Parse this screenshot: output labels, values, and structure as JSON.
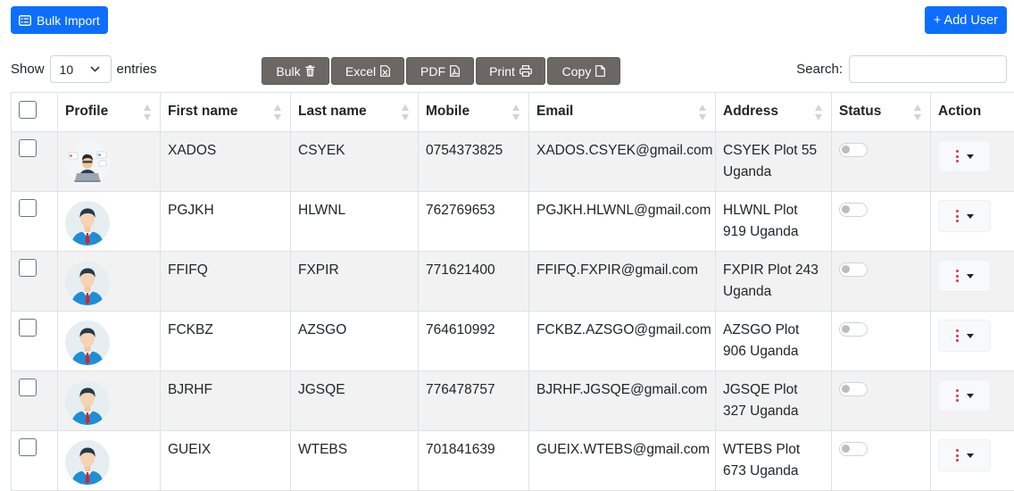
{
  "toolbar": {
    "bulk_import_label": "Bulk Import",
    "add_user_label": "+ Add User"
  },
  "length": {
    "show_label": "Show",
    "value": "10",
    "entries_label": "entries"
  },
  "exports": {
    "bulk": "Bulk",
    "excel": "Excel",
    "pdf": "PDF",
    "print": "Print",
    "copy": "Copy"
  },
  "search": {
    "label": "Search:",
    "value": ""
  },
  "columns": [
    "Profile",
    "First name",
    "Last name",
    "Mobile",
    "Email",
    "Address",
    "Status",
    "Action"
  ],
  "rows": [
    {
      "first": "XADOS",
      "last": "CSYEK",
      "mobile": "0754373825",
      "email": "XADOS.CSYEK@gmail.com",
      "address": "CSYEK Plot 55 Uganda",
      "avatar": "avatar-laptop-icon"
    },
    {
      "first": "PGJKH",
      "last": "HLWNL",
      "mobile": "762769653",
      "email": "PGJKH.HLWNL@gmail.com",
      "address": "HLWNL Plot 919 Uganda",
      "avatar": "avatar-businessman-icon"
    },
    {
      "first": "FFIFQ",
      "last": "FXPIR",
      "mobile": "771621400",
      "email": "FFIFQ.FXPIR@gmail.com",
      "address": "FXPIR Plot 243 Uganda",
      "avatar": "avatar-businessman-icon"
    },
    {
      "first": "FCKBZ",
      "last": "AZSGO",
      "mobile": "764610992",
      "email": "FCKBZ.AZSGO@gmail.com",
      "address": "AZSGO Plot 906 Uganda",
      "avatar": "avatar-businessman-icon"
    },
    {
      "first": "BJRHF",
      "last": "JGSQE",
      "mobile": "776478757",
      "email": "BJRHF.JGSQE@gmail.com",
      "address": "JGSQE Plot 327 Uganda",
      "avatar": "avatar-businessman-icon"
    },
    {
      "first": "GUEIX",
      "last": "WTEBS",
      "mobile": "701841639",
      "email": "GUEIX.WTEBS@gmail.com",
      "address": "WTEBS Plot 673 Uganda",
      "avatar": "avatar-businessman-icon"
    }
  ],
  "colors": {
    "primary": "#0d6efd",
    "export_bg": "#6c6763",
    "striped_row": "#f2f2f2",
    "action_dots": "#dc3545"
  }
}
